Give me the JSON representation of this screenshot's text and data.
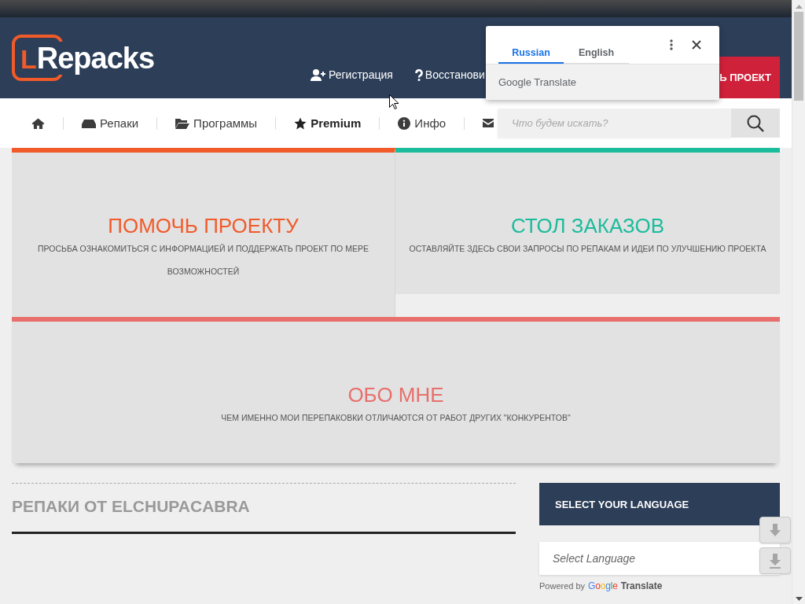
{
  "header": {
    "logo": "LRepacks",
    "links": [
      {
        "label": "Регистрация"
      },
      {
        "label": "Восстанови"
      }
    ],
    "button": "Ь ПРОЕКТ"
  },
  "nav": {
    "items": [
      {
        "kind": "icon",
        "highlighted": false
      },
      {
        "kind": "link",
        "label": "Репаки",
        "highlighted": false
      },
      {
        "kind": "link",
        "label": "Программы",
        "highlighted": false
      },
      {
        "kind": "link",
        "label": "Premium",
        "highlighted": true
      },
      {
        "kind": "link",
        "label": "Инфо",
        "highlighted": false
      },
      {
        "kind": "icon",
        "highlighted": false
      }
    ],
    "search": {
      "placeholder": "Что будем искать?"
    }
  },
  "translate_popup": {
    "tabs": [
      {
        "label": "Russian",
        "selected": true
      },
      {
        "label": "English",
        "selected": false
      }
    ],
    "footer": "Google Translate"
  },
  "banners": [
    {
      "title": "ПОМОЧЬ ПРОЕКТУ",
      "text": "ПРОСЬБА ОЗНАКОМИТЬСЯ С ИНФОРМАЦИЕЙ И ПОДДЕРЖАТЬ ПРОЕКТ ПО МЕРЕ ВОЗМОЖНОСТЕЙ",
      "color": "#f15a29"
    },
    {
      "title": "СТОЛ ЗАКАЗОВ",
      "text": "ОСТАВЛЯЙТЕ ЗДЕСЬ СВОИ ЗАПРОСЫ ПО РЕПАКАМ И ИДЕИ ПО УЛУЧШЕНИЮ ПРОЕКТА",
      "color": "#1abc9c"
    },
    {
      "title": "ОБО МНЕ",
      "text": "ЧЕМ ИМЕННО МОИ ПЕРЕПАКОВКИ ОТЛИЧАЮТСЯ ОТ РАБОТ ДРУГИХ \"КОНКУРЕНТОВ\"",
      "color": "#e86f6c"
    }
  ],
  "section": {
    "heading": "РЕПАКИ ОТ ELCHUPACABRA"
  },
  "language_widget": {
    "title": "SELECT YOUR LANGUAGE",
    "select": {
      "value": "Select Language"
    },
    "powered_by": "Powered by",
    "brand": "Google",
    "product": "Translate"
  }
}
